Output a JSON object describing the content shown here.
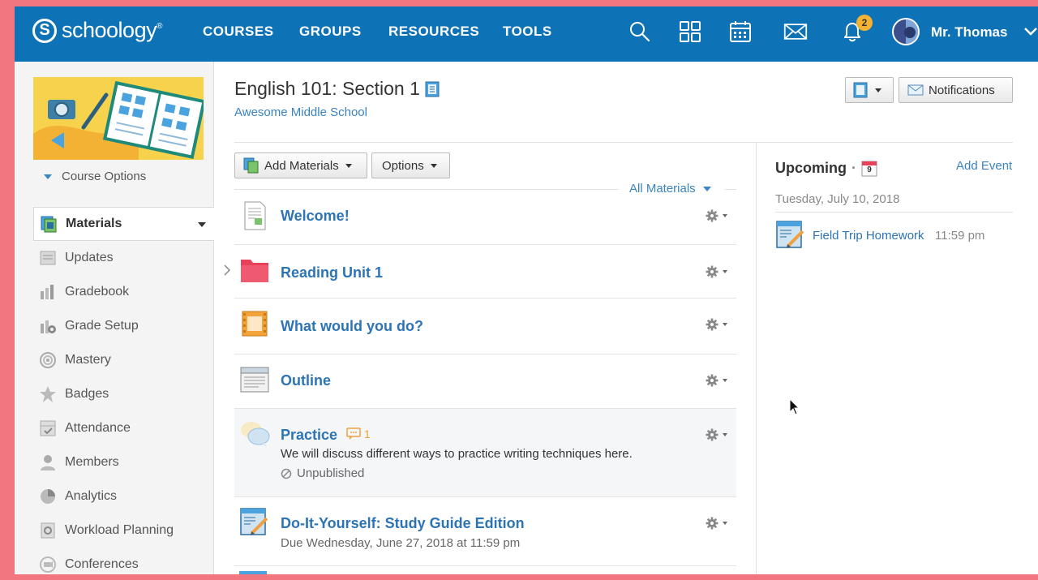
{
  "brand": {
    "logo_letter": "S",
    "wordmark": "schoology",
    "trademark": "®"
  },
  "nav": {
    "links": [
      "COURSES",
      "GROUPS",
      "RESOURCES",
      "TOOLS"
    ],
    "icons": [
      "search-icon",
      "apps-grid-icon",
      "calendar-icon",
      "mail-icon",
      "bell-icon"
    ],
    "notification_count": "2",
    "user_name": "Mr. Thomas"
  },
  "sidebar": {
    "course_options": "Course Options",
    "items": [
      {
        "label": "Materials",
        "icon": "materials-icon",
        "active": true
      },
      {
        "label": "Updates",
        "icon": "updates-icon"
      },
      {
        "label": "Gradebook",
        "icon": "gradebook-icon"
      },
      {
        "label": "Grade Setup",
        "icon": "grade-setup-icon"
      },
      {
        "label": "Mastery",
        "icon": "mastery-icon"
      },
      {
        "label": "Badges",
        "icon": "badge-icon"
      },
      {
        "label": "Attendance",
        "icon": "attendance-icon"
      },
      {
        "label": "Members",
        "icon": "members-icon"
      },
      {
        "label": "Analytics",
        "icon": "analytics-icon"
      },
      {
        "label": "Workload Planning",
        "icon": "workload-icon"
      },
      {
        "label": "Conferences",
        "icon": "conferences-icon"
      }
    ]
  },
  "course": {
    "title": "English 101: Section 1",
    "school": "Awesome Middle School"
  },
  "header_buttons": {
    "notifications": "Notifications"
  },
  "toolbar": {
    "add_materials": "Add Materials",
    "options": "Options",
    "filter": "All Materials"
  },
  "materials": [
    {
      "title": "Welcome!",
      "icon": "page-icon"
    },
    {
      "title": "Reading Unit 1",
      "icon": "folder-icon"
    },
    {
      "title": "What would you do?",
      "icon": "media-album-icon"
    },
    {
      "title": "Outline",
      "icon": "document-icon"
    },
    {
      "title": "Practice",
      "icon": "discussion-icon",
      "comment_count": "1",
      "description": "We will discuss different ways to practice writing techniques here.",
      "status": "Unpublished"
    },
    {
      "title": "Do-It-Yourself: Study Guide Edition",
      "icon": "assignment-icon",
      "due": "Due Wednesday, June 27, 2018 at 11:59 pm"
    }
  ],
  "upcoming": {
    "title": "Upcoming",
    "separator": "·",
    "calendar_day": "9",
    "add_event": "Add Event",
    "date": "Tuesday, July 10, 2018",
    "events": [
      {
        "title": "Field Trip Homework",
        "time": "11:59 pm",
        "icon": "assignment-icon"
      }
    ]
  },
  "colors": {
    "nav_bg": "#0d72b6",
    "link": "#2c74b5",
    "badge": "#f3b233",
    "folder": "#e8425a",
    "frame": "#f2767f"
  }
}
